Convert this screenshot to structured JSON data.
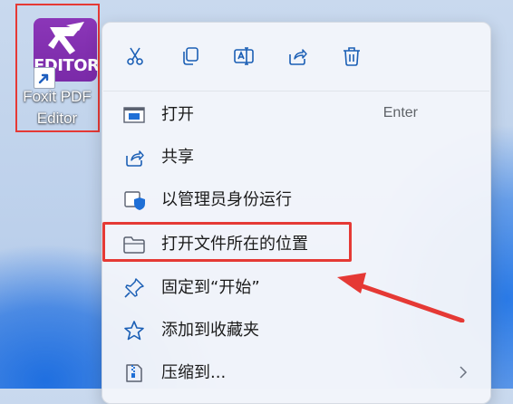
{
  "desktop_icon": {
    "wordmark": "EDITOR",
    "label_line1": "Foxit PDF",
    "label_line2": "Editor",
    "icon_color": "#8b36b8"
  },
  "toolbar": {
    "cut_icon": "scissors-icon",
    "copy_icon": "copy-icon",
    "rename_icon": "rename-icon",
    "share_icon": "share-icon",
    "delete_icon": "trash-icon"
  },
  "menu": {
    "items": [
      {
        "label": "打开",
        "accel": "Enter",
        "icon": "open-app-icon"
      },
      {
        "label": "共享",
        "icon": "share-icon"
      },
      {
        "label": "以管理员身份运行",
        "icon": "admin-shield-icon"
      },
      {
        "label": "打开文件所在的位置",
        "icon": "folder-icon"
      },
      {
        "label": "固定到“开始”",
        "icon": "pin-icon"
      },
      {
        "label": "添加到收藏夹",
        "icon": "star-icon"
      },
      {
        "label": "压缩到...",
        "icon": "zip-icon",
        "submenu": true
      }
    ]
  },
  "annotation_color": "#e53935"
}
